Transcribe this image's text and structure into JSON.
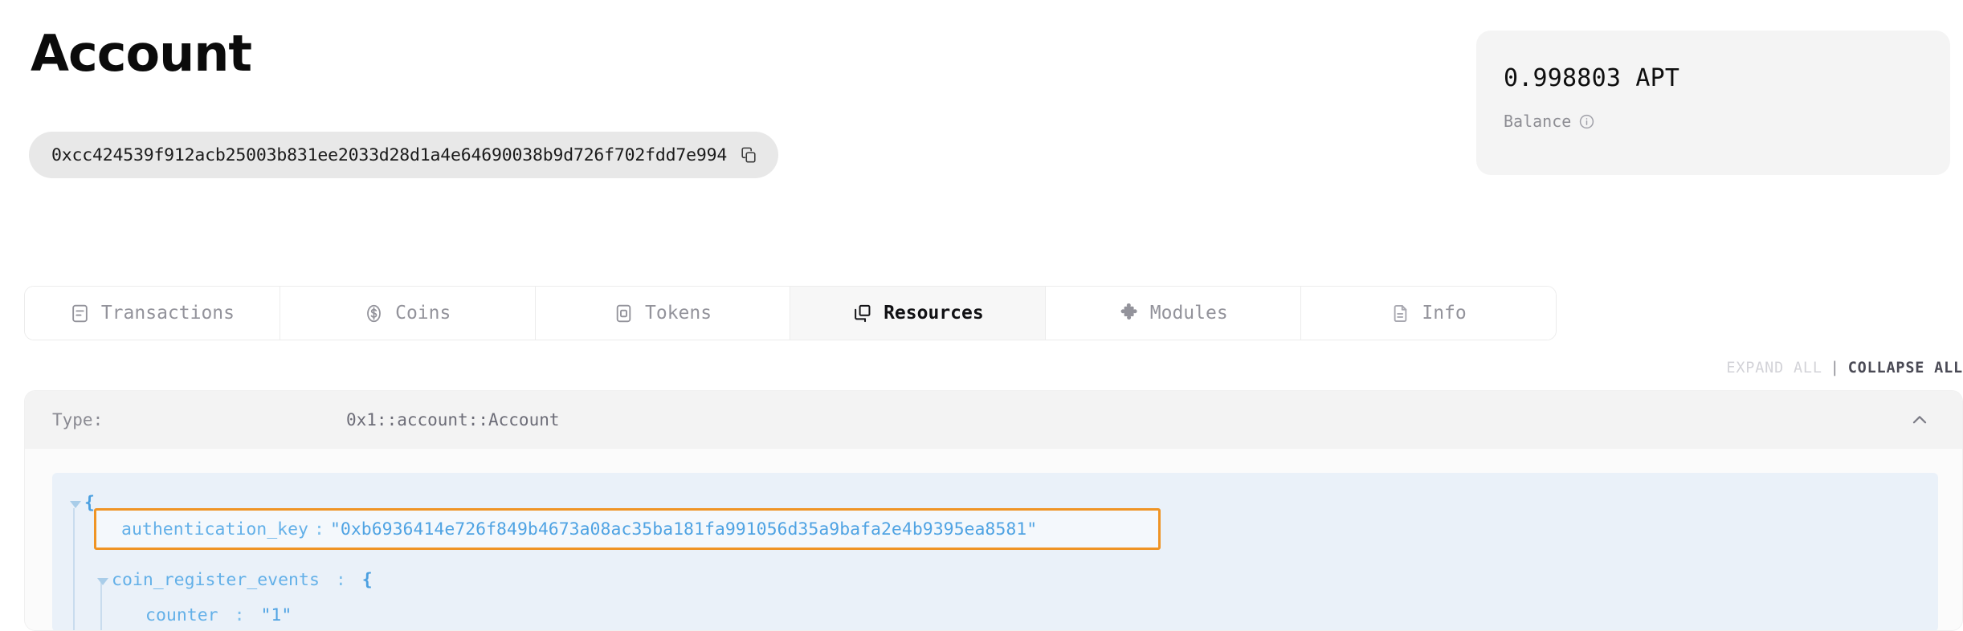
{
  "header": {
    "title": "Account",
    "address": "0xcc424539f912acb25003b831ee2033d28d1a4e64690038b9d726f702fdd7e994",
    "copy_icon": "copy-icon"
  },
  "balance_card": {
    "amount": "0.998803 APT",
    "label": "Balance",
    "info_icon": "info-circle-icon"
  },
  "tabs": [
    {
      "label": "Transactions",
      "icon": "transactions-icon",
      "active": false
    },
    {
      "label": "Coins",
      "icon": "coins-icon",
      "active": false
    },
    {
      "label": "Tokens",
      "icon": "tokens-icon",
      "active": false
    },
    {
      "label": "Resources",
      "icon": "resources-icon",
      "active": true
    },
    {
      "label": "Modules",
      "icon": "puzzle-icon",
      "active": false
    },
    {
      "label": "Info",
      "icon": "document-icon",
      "active": false
    }
  ],
  "toolbar": {
    "expand_all": "EXPAND ALL",
    "separator": "|",
    "collapse_all": "COLLAPSE ALL"
  },
  "resource": {
    "type_label": "Type:",
    "type_value": "0x1::account::Account",
    "collapse_icon": "chevron-up-icon"
  },
  "json_viewer": {
    "open_brace": "{",
    "highlighted": {
      "key": "authentication_key",
      "colon": ":",
      "value": "\"0xb6936414e726f849b4673a08ac35ba181fa991056d35a9bafa2e4b9395ea8581\""
    },
    "line_coin_register": {
      "key": "coin_register_events",
      "colon": ":",
      "brace": "{"
    },
    "line_counter": {
      "key": "counter",
      "colon": ":",
      "value": "\"1\""
    }
  },
  "colors": {
    "accent_highlight": "#ef9425",
    "json_bg": "#eaf1f9",
    "json_text": "#5aa9e6",
    "card_bg": "#f4f4f4",
    "pill_bg": "#e8e8e8"
  }
}
